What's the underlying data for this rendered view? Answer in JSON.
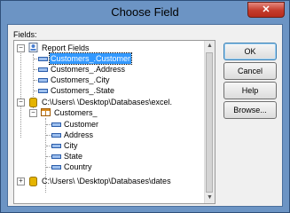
{
  "window": {
    "title": "Choose Field",
    "close": "✕"
  },
  "fields_label": "Fields:",
  "tree": [
    {
      "label": "Report Fields",
      "expander": "−",
      "icon": "report-icon"
    },
    {
      "label": "Customers_.Customer",
      "icon": "field-icon",
      "selected": true
    },
    {
      "label": "Customers_.Address",
      "icon": "field-icon"
    },
    {
      "label": "Customers_.City",
      "icon": "field-icon"
    },
    {
      "label": "Customers_.State",
      "icon": "field-icon"
    },
    {
      "label": "C:\\Users\\           \\Desktop\\Databases\\excel.",
      "expander": "−",
      "icon": "database-icon"
    },
    {
      "label": "Customers_",
      "expander": "−",
      "icon": "table-icon"
    },
    {
      "label": "Customer",
      "icon": "field-icon"
    },
    {
      "label": "Address",
      "icon": "field-icon"
    },
    {
      "label": "City",
      "icon": "field-icon"
    },
    {
      "label": "State",
      "icon": "field-icon"
    },
    {
      "label": "Country",
      "icon": "field-icon"
    },
    {
      "label": "C:\\Users\\           \\Desktop\\Databases\\dates",
      "expander": "+",
      "icon": "database-icon"
    }
  ],
  "buttons": {
    "ok": "OK",
    "cancel": "Cancel",
    "help": "Help",
    "browse": "Browse..."
  }
}
